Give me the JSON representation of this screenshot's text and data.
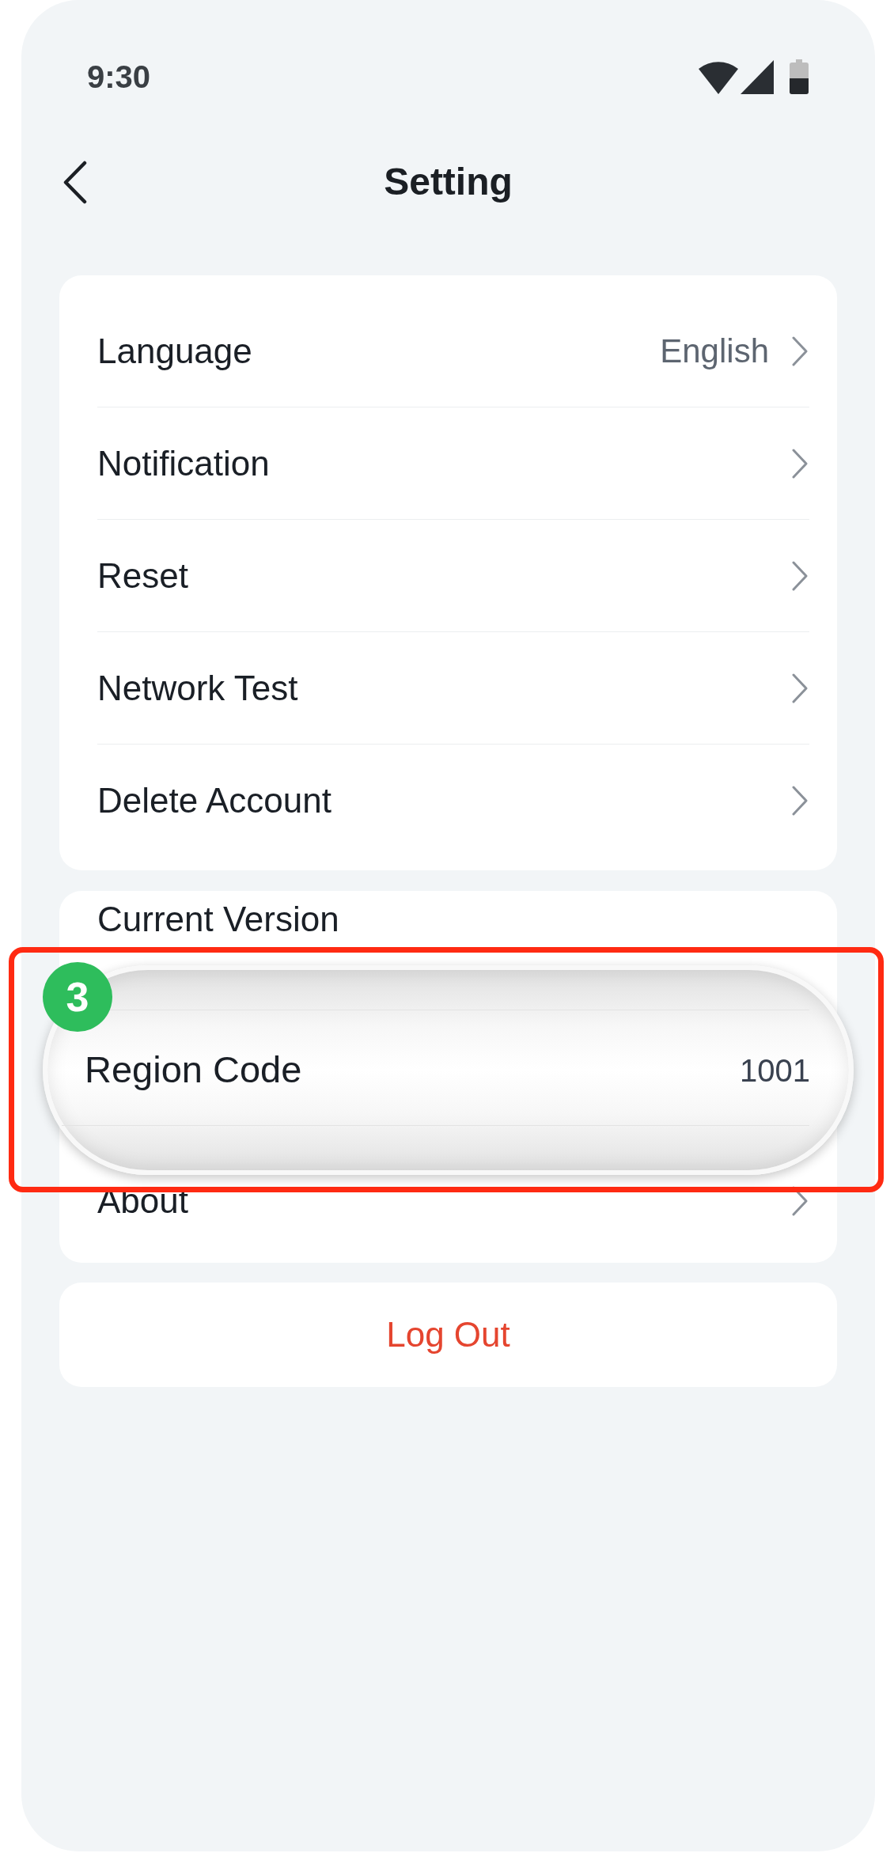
{
  "status_bar": {
    "time": "9:30"
  },
  "header": {
    "title": "Setting"
  },
  "groups": [
    {
      "rows": [
        {
          "kind": "value_link",
          "label": "Language",
          "value": "English"
        },
        {
          "kind": "link",
          "label": "Notification"
        },
        {
          "kind": "link",
          "label": "Reset"
        },
        {
          "kind": "link",
          "label": "Network Test"
        },
        {
          "kind": "link",
          "label": "Delete Account"
        }
      ]
    },
    {
      "rows": [
        {
          "kind": "plain",
          "label": "Current Version"
        },
        {
          "kind": "magnified",
          "label": "Region Code",
          "value": "1001",
          "badge": "3"
        },
        {
          "kind": "link",
          "label": "About"
        }
      ]
    }
  ],
  "logout_button": {
    "label": "Log Out"
  }
}
